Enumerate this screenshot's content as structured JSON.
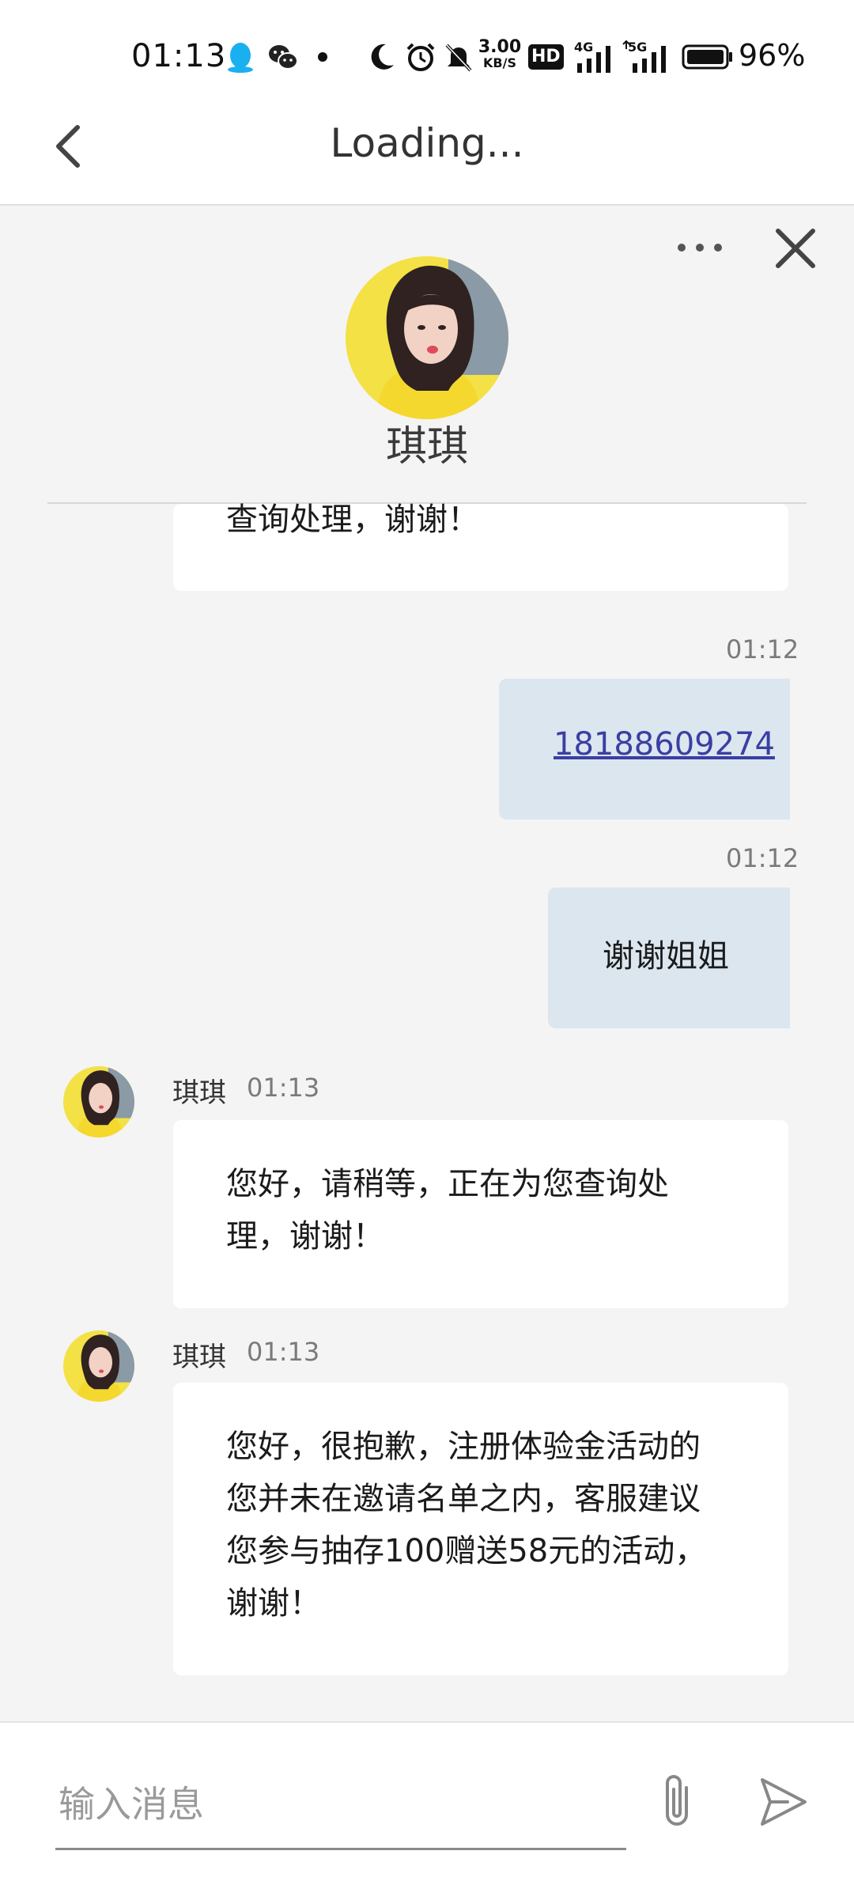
{
  "status_bar": {
    "time": "01:13",
    "speed_value": "3.00",
    "speed_unit": "KB/S",
    "hd_badge": "HD",
    "net_4g": "4G",
    "net_5g": "5G",
    "battery": "96%",
    "icons": [
      "qq-icon",
      "wechat-icon",
      "dot-icon",
      "moon-icon",
      "alarm-icon",
      "mute-icon",
      "signal-icon",
      "battery-icon"
    ]
  },
  "header": {
    "title": "Loading..."
  },
  "chat_header": {
    "agent_name": "琪琪"
  },
  "messages": [
    {
      "dir": "in",
      "text": "查询处理，谢谢！"
    },
    {
      "dir": "out",
      "time": "01:12",
      "text": "18188609274",
      "is_link": true
    },
    {
      "dir": "out",
      "time": "01:12",
      "text": "谢谢姐姐"
    },
    {
      "dir": "in",
      "sender": "琪琪",
      "time": "01:13",
      "lines": [
        "您好，请稍等，正在为您查询处",
        "理，谢谢！"
      ]
    },
    {
      "dir": "in",
      "sender": "琪琪",
      "time": "01:13",
      "lines": [
        "您好，很抱歉，注册体验金活动的",
        "您并未在邀请名单之内，客服建议",
        "您参与抽存100赠送58元的活动，",
        "谢谢！"
      ]
    }
  ],
  "composer": {
    "placeholder": "输入消息"
  },
  "colors": {
    "bubble_out": "#dbe6ef",
    "bubble_in": "#ffffff",
    "background": "#f4f4f4",
    "link": "#3a3fa3"
  }
}
